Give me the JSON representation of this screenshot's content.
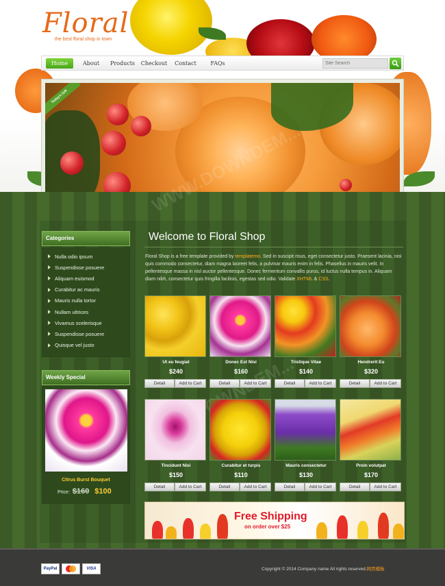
{
  "logo": {
    "text": "Floral",
    "tagline": "the best floral shop in town"
  },
  "nav": {
    "items": [
      "Home",
      "About",
      "Products",
      "Checkout",
      "Contact",
      "FAQs"
    ],
    "active": "Home"
  },
  "search": {
    "placeholder": "Site Search",
    "icon": "search-icon"
  },
  "banner": {
    "ribbon": "Today's Gift"
  },
  "sidebar": {
    "categories_title": "Categories",
    "categories": [
      "Nulla odio ipsum",
      "Suspendisse posuere",
      "Aliquam euismod",
      "Curabitur ac mauris",
      "Mauris nulla tortor",
      "Nullam ultrices",
      "Vivamus scelerisque",
      "Suspendisse posuere",
      "Quisque vel justo"
    ],
    "special_title": "Weekly Special",
    "special": {
      "name": "Citrus Burst Bouquet",
      "price_label": "Price:",
      "old_price": "$160",
      "new_price": "$100"
    }
  },
  "content": {
    "title": "Welcome to Floral Shop",
    "text_pre": "Floral Shop is a free template provided by ",
    "text_link": "templatemo",
    "text_mid": ". Sed in suscipit risus, eget consectetur justo. Praesent lacinia, nisi quis commodo consectetur, diam magna laoreet felis, a pulvinar mauris enim in felis. Phasellus in mauris velit. In pellentesque massa in nisl auctor pellentesque. Donec fermentum convallis purus, id luctus nulla tempus in. Aliquam diam nibh, consectetur quis fringilla facilisis, egestas sed odio. Validate ",
    "xhtml": "XHTML",
    "amp": " & ",
    "css": "CSS",
    "text_end": "."
  },
  "product_buttons": {
    "detail": "Detail",
    "cart": "Add to Cart"
  },
  "products": [
    {
      "name": "Ut eu feugiat",
      "price": "$240"
    },
    {
      "name": "Donec Est Nisi",
      "price": "$160"
    },
    {
      "name": "Tristique Vitae",
      "price": "$140"
    },
    {
      "name": "Hendrerit Eu",
      "price": "$320"
    },
    {
      "name": "Tincidunt Nisi",
      "price": "$150"
    },
    {
      "name": "Curabitur et turpis",
      "price": "$110"
    },
    {
      "name": "Mauris consectetur",
      "price": "$130"
    },
    {
      "name": "Proin volutpat",
      "price": "$170"
    }
  ],
  "shipping": {
    "headline": "Free Shipping",
    "sub": "on order over $25"
  },
  "footer": {
    "payments": [
      "PayPal",
      "MasterCard",
      "VISA"
    ],
    "copyright": "Copyright © 2014 Company name All rights reserved.",
    "link": "网页模板"
  },
  "colors": {
    "accent_green": "#4aa51a",
    "price_yellow": "#ffcc33",
    "link_orange": "#ffb020",
    "ship_red": "#e11a2a"
  }
}
